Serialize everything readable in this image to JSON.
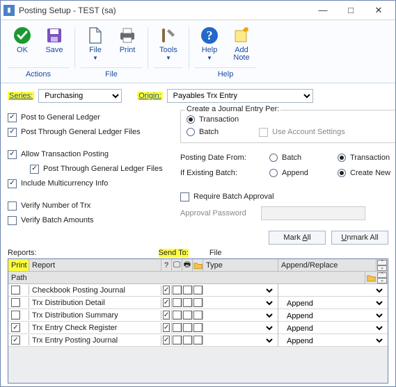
{
  "window": {
    "title": "Posting Setup  -  TEST (sa)"
  },
  "ribbon": {
    "ok": "OK",
    "save": "Save",
    "file": "File",
    "print": "Print",
    "tools": "Tools",
    "help": "Help",
    "addnote": "Add\nNote",
    "group_actions": "Actions",
    "group_file": "File",
    "group_help": "Help"
  },
  "labels": {
    "series": "Series:",
    "origin": "Origin:",
    "reports": "Reports:",
    "sendto": "Send To:",
    "file": "File"
  },
  "series_value": "Purchasing",
  "origin_value": "Payables Trx Entry",
  "left": {
    "post_gl": "Post to General Ledger",
    "post_thru_gl": "Post Through General Ledger Files",
    "allow_tx": "Allow Transaction Posting",
    "post_thru_gl2": "Post Through General Ledger Files",
    "inc_mc": "Include Multicurrency Info",
    "verify_num": "Verify Number of Trx",
    "verify_amt": "Verify Batch Amounts"
  },
  "right": {
    "journal_per": "Create a Journal Entry Per:",
    "transaction": "Transaction",
    "batch": "Batch",
    "use_acct": "Use Account Settings",
    "date_from": "Posting Date From:",
    "if_existing": "If Existing Batch:",
    "append": "Append",
    "create_new": "Create New",
    "req_batch": "Require Batch Approval",
    "approval_pw": "Approval Password"
  },
  "buttons": {
    "mark_all": "Mark All",
    "unmark_all": "Unmark All"
  },
  "u_accel": {
    "mark_all": "A",
    "unmark_all": "U"
  },
  "grid": {
    "hdr_print": "Print",
    "hdr_report": "Report",
    "hdr_q": "?",
    "hdr_type": "Type",
    "hdr_ar": "Append/Replace",
    "hdr_path": "Path",
    "rows": [
      {
        "print": false,
        "report": "Checkbook Posting Journal",
        "q": true,
        "i1": false,
        "i2": false,
        "i3": false,
        "type": "",
        "ar": ""
      },
      {
        "print": false,
        "report": "Trx Distribution Detail",
        "q": true,
        "i1": false,
        "i2": false,
        "i3": false,
        "type": "",
        "ar": "Append"
      },
      {
        "print": false,
        "report": "Trx Distribution Summary",
        "q": true,
        "i1": false,
        "i2": false,
        "i3": false,
        "type": "",
        "ar": "Append"
      },
      {
        "print": true,
        "report": "Trx Entry Check Register",
        "q": true,
        "i1": false,
        "i2": false,
        "i3": false,
        "type": "",
        "ar": "Append"
      },
      {
        "print": true,
        "report": "Trx Entry Posting Journal",
        "q": true,
        "i1": false,
        "i2": false,
        "i3": false,
        "type": "",
        "ar": "Append"
      }
    ]
  }
}
